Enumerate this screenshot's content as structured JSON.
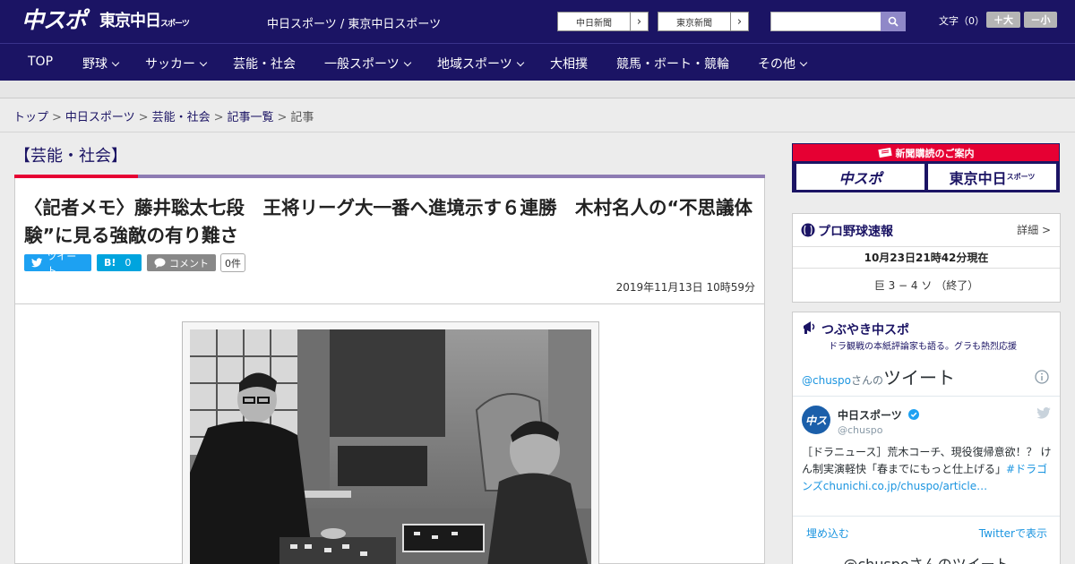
{
  "header": {
    "logo_chuspo": "中スポ",
    "logo_tokyo": "東京中日",
    "logo_tokyo_small": "スポーツ",
    "site_names": "中日スポーツ / 東京中日スポーツ",
    "paper_buttons": [
      "中日新聞",
      "東京新聞"
    ],
    "font_size_label": "文字（0）",
    "font_plus": "＋大",
    "font_minus": "－小"
  },
  "nav": {
    "items": [
      "TOP",
      "野球",
      "サッカー",
      "芸能・社会",
      "一般スポーツ",
      "地域スポーツ",
      "大相撲",
      "競馬・ボート・競輪",
      "その他"
    ]
  },
  "breadcrumb": {
    "items": [
      "トップ",
      "中日スポーツ",
      "芸能・社会",
      "記事一覧"
    ],
    "current": "記事",
    "separator": ">"
  },
  "article": {
    "category": "【芸能・社会】",
    "headline": "〈記者メモ〉藤井聡太七段　王将リーグ大一番へ進境示す６連勝　木村名人の“不思議体験”に見る強敵の有り難さ",
    "tweet_label": "ツイート",
    "hatena_label": "B!",
    "hatena_count": "0",
    "comment_label": "コメント",
    "comment_count": "0件",
    "date": "2019年11月13日 10時59分"
  },
  "sidebar": {
    "promo_title": "新聞購読のご案内",
    "promo_logos": [
      "中スポ",
      "東京中日"
    ],
    "promo_logo_small": "スポーツ",
    "baseball": {
      "title": "プロ野球速報",
      "detail": "詳細",
      "timestamp": "10月23日21時42分現在",
      "score": "巨 3 − 4 ソ （終了）"
    },
    "tsubuyaki": {
      "title": "つぶやき中スポ",
      "subtitle": "ドラ観戦の本紙評論家も語る。グラも熱烈応援",
      "tweets_prefix": "@chuspo",
      "tweets_suffix": "さんの",
      "tweets_word": "ツイート",
      "account_name": "中日スポーツ",
      "account_handle": "@chuspo",
      "tweet_text": "［ドラニュース］荒木コーチ、現役復帰意欲！？ けん制実演軽快「春までにもっと仕上げる」",
      "tweet_hashtag": "#ドラゴンズ",
      "tweet_link": "chunichi.co.jp/chuspo/article…",
      "embed": "埋め込む",
      "view_on_twitter": "Twitterで表示",
      "bottom_text": "@chuspoさんのツイート"
    }
  },
  "colors": {
    "brand": "#1b1464",
    "accent_red": "#e60033",
    "twitter": "#1da1f2"
  }
}
